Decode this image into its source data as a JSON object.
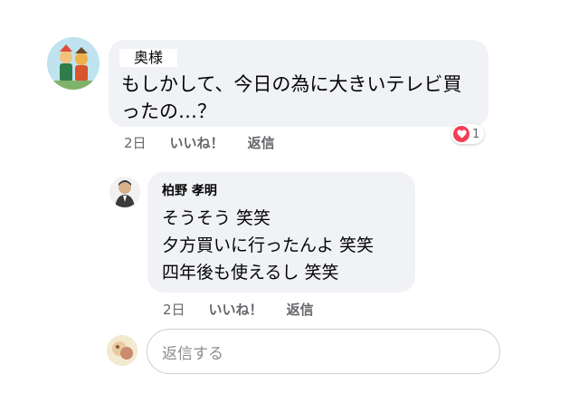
{
  "comment": {
    "author": "奥様",
    "text_line1": "もしかして、今日の為に大きいテレビ買",
    "text_line2": "ったの…？",
    "actions": {
      "time": "2日",
      "like": "いいね！",
      "reply": "返信"
    },
    "reaction": {
      "type": "heart",
      "count": "1",
      "color": "#f33e58"
    }
  },
  "reply": {
    "author": "柏野 孝明",
    "lines": [
      "そうそう 笑笑",
      "夕方買いに行ったんよ 笑笑",
      "四年後も使えるし 笑笑"
    ],
    "actions": {
      "time": "2日",
      "like": "いいね！",
      "reply": "返信"
    }
  },
  "reply_box": {
    "placeholder": "返信する"
  },
  "colors": {
    "bubble_bg": "#f0f2f5",
    "meta_text": "#65676b",
    "input_border": "#ccd0d5"
  }
}
